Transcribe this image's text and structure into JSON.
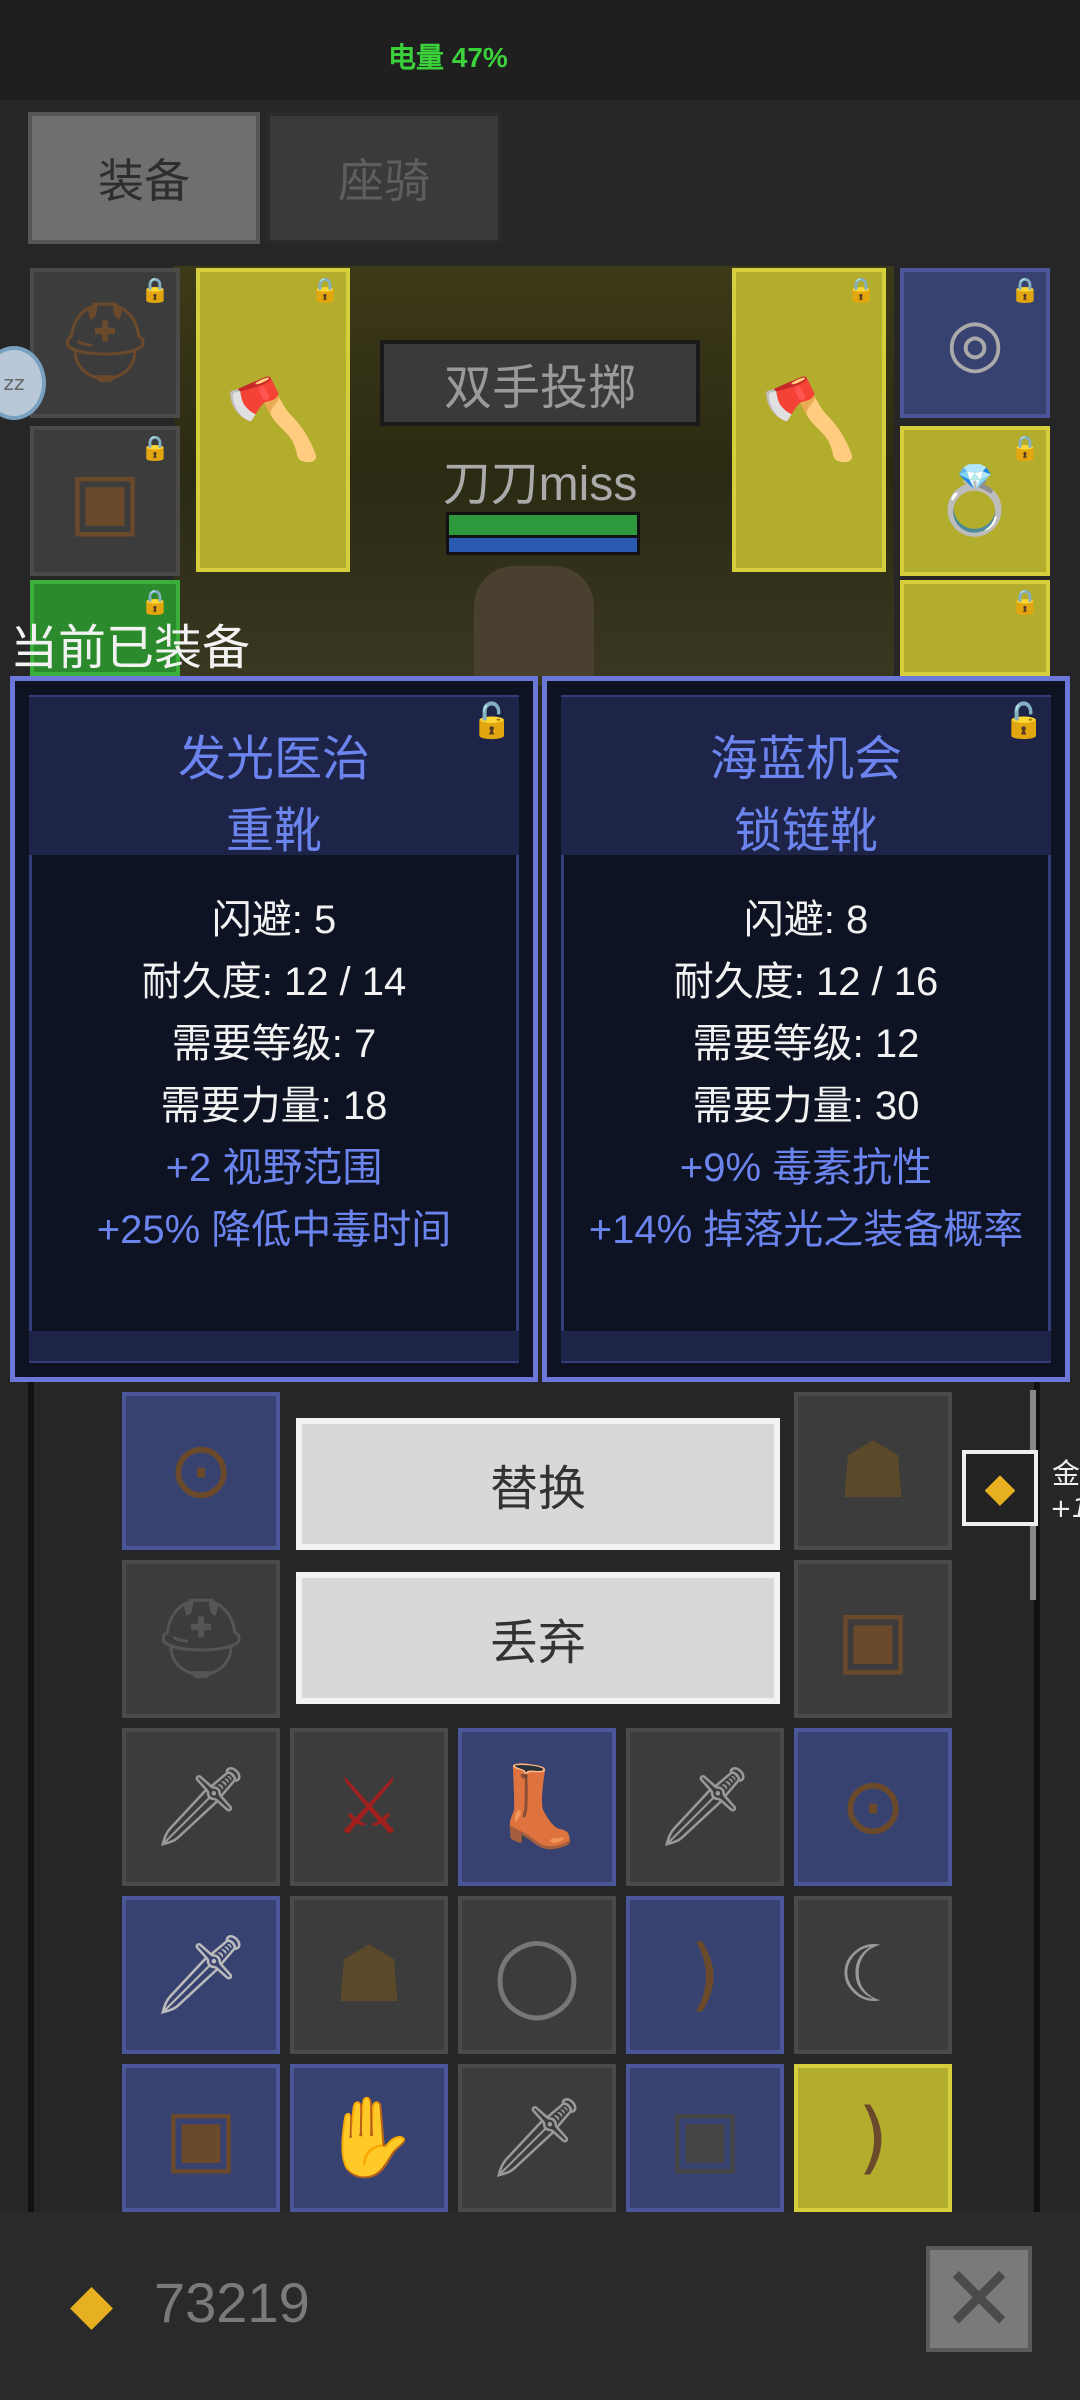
{
  "status": {
    "battery": "电量 47%"
  },
  "tabs": [
    {
      "label": "装备",
      "active": true
    },
    {
      "label": "座骑",
      "active": false
    }
  ],
  "character": {
    "skill_bubble": "双手投掷",
    "player_name": "刀刀miss",
    "sleep_badge": "zz"
  },
  "equipped_section_label": "当前已装备",
  "panels": [
    {
      "name": "发光医治",
      "type": "重靴",
      "stats": [
        "闪避: 5",
        "耐久度: 12 / 14",
        "需要等级: 7",
        "需要力量: 18"
      ],
      "bonuses": [
        "+2 视野范围",
        "+25% 降低中毒时间"
      ]
    },
    {
      "name": "海蓝机会",
      "type": "锁链靴",
      "stats": [
        "闪避: 8",
        "耐久度: 12 / 16",
        "需要等级: 12",
        "需要力量: 30"
      ],
      "bonuses": [
        "+9% 毒素抗性",
        "+14% 掉落光之装备概率"
      ]
    }
  ],
  "actions": {
    "replace": "替换",
    "discard": "丢弃"
  },
  "side_gold": {
    "label": "金",
    "value": "+1"
  },
  "footer": {
    "gold_amount": "73219"
  },
  "icons": {
    "lock": "lock-icon",
    "unlock": "unlock-icon",
    "gold": "gold-coins-icon",
    "close": "close-icon"
  },
  "colors": {
    "accent_text": "#6c84ee",
    "panel_border": "#6b78d9",
    "battery": "#3ad13a",
    "yellow_slot": "#b3ad2e",
    "blue_slot": "#384270"
  }
}
